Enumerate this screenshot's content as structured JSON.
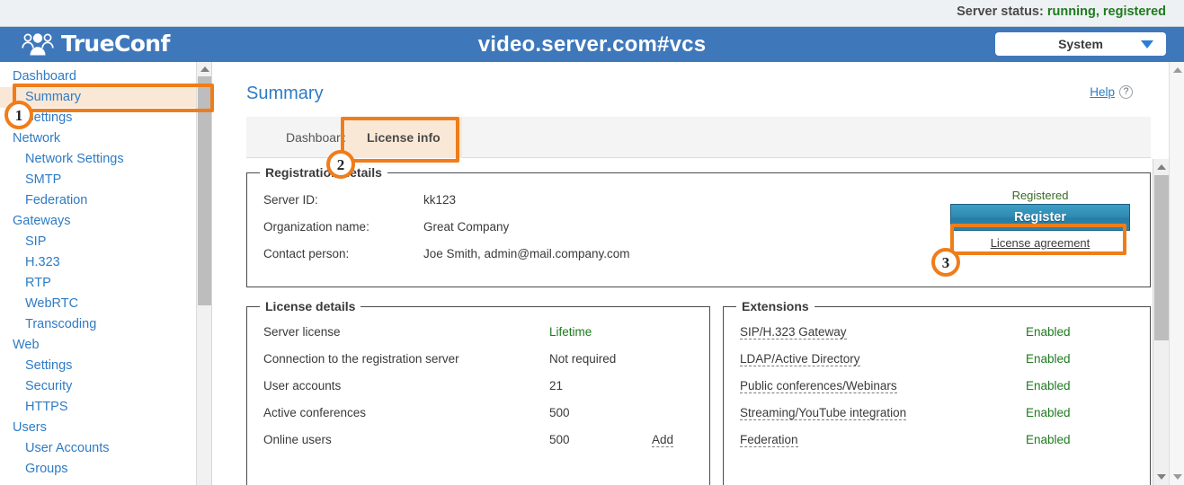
{
  "statusbar": {
    "label": "Server status:",
    "value": "running, registered"
  },
  "header": {
    "brand": "TrueConf",
    "title": "video.server.com#vcs",
    "scope_select": {
      "value": "System",
      "caret": "chevron-down-icon"
    }
  },
  "sidebar": {
    "items": [
      {
        "label": "Dashboard",
        "level": 0,
        "highlight": false
      },
      {
        "label": "Summary",
        "level": 1,
        "highlight": true
      },
      {
        "label": "Settings",
        "level": 1,
        "highlight": false
      },
      {
        "label": "Network",
        "level": 0,
        "highlight": false
      },
      {
        "label": "Network Settings",
        "level": 1,
        "highlight": false
      },
      {
        "label": "SMTP",
        "level": 1,
        "highlight": false
      },
      {
        "label": "Federation",
        "level": 1,
        "highlight": false
      },
      {
        "label": "Gateways",
        "level": 0,
        "highlight": false
      },
      {
        "label": "SIP",
        "level": 1,
        "highlight": false
      },
      {
        "label": "H.323",
        "level": 1,
        "highlight": false
      },
      {
        "label": "RTP",
        "level": 1,
        "highlight": false
      },
      {
        "label": "WebRTC",
        "level": 1,
        "highlight": false
      },
      {
        "label": "Transcoding",
        "level": 1,
        "highlight": false
      },
      {
        "label": "Web",
        "level": 0,
        "highlight": false
      },
      {
        "label": "Settings",
        "level": 1,
        "highlight": false
      },
      {
        "label": "Security",
        "level": 1,
        "highlight": false
      },
      {
        "label": "HTTPS",
        "level": 1,
        "highlight": false
      },
      {
        "label": "Users",
        "level": 0,
        "highlight": false
      },
      {
        "label": "User Accounts",
        "level": 1,
        "highlight": false
      },
      {
        "label": "Groups",
        "level": 1,
        "highlight": false
      }
    ]
  },
  "main": {
    "page_title": "Summary",
    "help": {
      "label": "Help",
      "icon": "question-mark-icon"
    },
    "tabs": [
      {
        "label": "Dashboard",
        "active": false
      },
      {
        "label": "License info",
        "active": true
      }
    ],
    "registration_details": {
      "legend": "Registration details",
      "rows": [
        {
          "label": "Server ID:",
          "value": "kk123"
        },
        {
          "label": "Organization name:",
          "value": "Great Company"
        },
        {
          "label": "Contact person:",
          "value": "Joe Smith, admin@mail.company.com"
        }
      ],
      "status": "Registered",
      "register_button": "Register",
      "license_agreement_link": "License agreement"
    },
    "license_details": {
      "legend": "License details",
      "rows": [
        {
          "label": "Server license",
          "value": "Lifetime",
          "green": true,
          "extra": ""
        },
        {
          "label": "Connection to the registration server",
          "value": "Not required",
          "green": false,
          "extra": ""
        },
        {
          "label": "User accounts",
          "value": "21",
          "green": false,
          "extra": ""
        },
        {
          "label": "Active conferences",
          "value": "500",
          "green": false,
          "extra": ""
        },
        {
          "label": "Online users",
          "value": "500",
          "green": false,
          "extra": "Add"
        }
      ]
    },
    "extensions": {
      "legend": "Extensions",
      "rows": [
        {
          "label": "SIP/H.323 Gateway",
          "value": "Enabled"
        },
        {
          "label": "LDAP/Active Directory",
          "value": "Enabled"
        },
        {
          "label": "Public conferences/Webinars",
          "value": "Enabled"
        },
        {
          "label": "Streaming/YouTube integration",
          "value": "Enabled"
        },
        {
          "label": "Federation",
          "value": "Enabled"
        }
      ]
    }
  },
  "annotations": {
    "markers": [
      {
        "number": "1"
      },
      {
        "number": "2"
      },
      {
        "number": "3"
      }
    ],
    "accent_color": "#ef7d1a",
    "highlight_fill": "#fae8d7"
  },
  "colors": {
    "header_blue": "#3e78bb",
    "link_blue": "#2f7bc4",
    "status_green": "#1f7a1f",
    "orange": "#ef7d1a"
  }
}
